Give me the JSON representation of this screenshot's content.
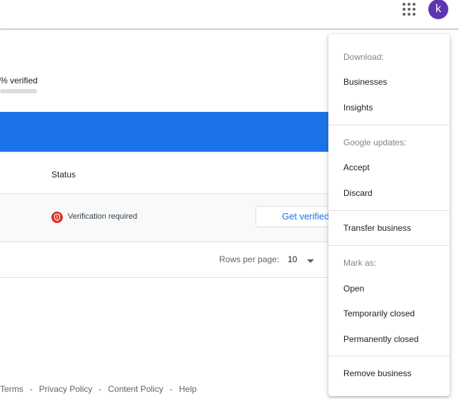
{
  "header": {
    "apps_icon": "apps-grid-icon",
    "avatar_letter": "k",
    "avatar_color": "#5e35b1"
  },
  "summary": {
    "verified_text": "% verified"
  },
  "table": {
    "status_header": "Status",
    "row": {
      "status_text": "Verification required",
      "status_icon": "warning-shield-icon",
      "action_label": "Get verified"
    },
    "pagination": {
      "rows_per_page_label": "Rows per page:",
      "rows_per_page_value": "10"
    }
  },
  "footer": {
    "links": [
      "Terms",
      "Privacy Policy",
      "Content Policy",
      "Help"
    ],
    "separator": "-"
  },
  "menu": {
    "download_heading": "Download:",
    "download_items": [
      "Businesses",
      "Insights"
    ],
    "updates_heading": "Google updates:",
    "updates_items": [
      "Accept",
      "Discard"
    ],
    "transfer_label": "Transfer business",
    "mark_heading": "Mark as:",
    "mark_items": [
      "Open",
      "Temporarily closed",
      "Permanently closed"
    ],
    "remove_label": "Remove business"
  },
  "colors": {
    "accent": "#1a73e8",
    "warning": "#d93025"
  }
}
